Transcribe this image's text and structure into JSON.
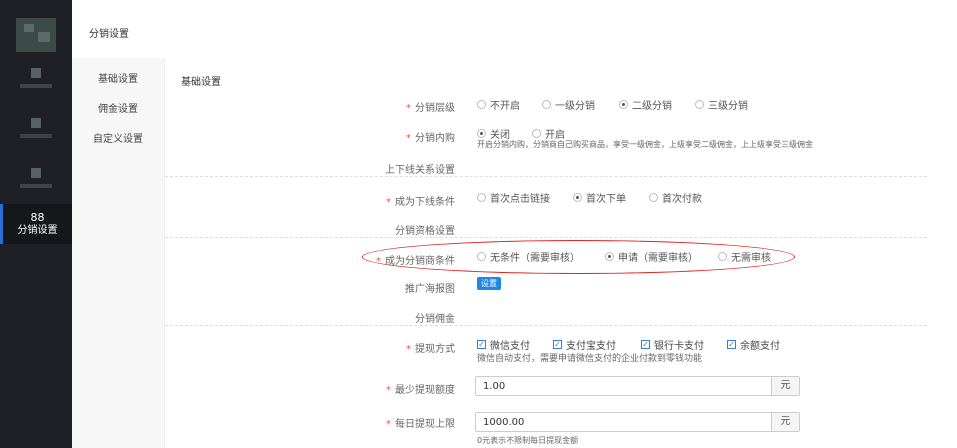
{
  "topbar": {
    "title": "分销设置"
  },
  "sidebar": {
    "active": {
      "icon": "88",
      "label": "分销设置"
    }
  },
  "subnav": {
    "items": [
      "基础设置",
      "佣金设置",
      "自定义设置"
    ]
  },
  "main": {
    "section_title": "基础设置",
    "level": {
      "label": "分销层级",
      "options": [
        "不开启",
        "一级分销",
        "二级分销",
        "三级分销"
      ],
      "selected": "二级分销"
    },
    "inner": {
      "label": "分销内购",
      "options": [
        "关闭",
        "开启"
      ],
      "selected": "关闭",
      "hint": "开启分销内购，分销商自己购买商品，享受一级佣金，上级享受二级佣金，上上级享受三级佣金"
    },
    "relation_heading": "上下线关系设置",
    "downline": {
      "label": "成为下线条件",
      "options": [
        "首次点击链接",
        "首次下单",
        "首次付款"
      ],
      "selected": "首次下单"
    },
    "qualification_heading": "分销资格设置",
    "distributor": {
      "label": "成为分销商条件",
      "options": [
        "无条件（需要审核）",
        "申请（需要审核）",
        "无需审核"
      ],
      "selected": "申请（需要审核）"
    },
    "poster": {
      "label": "推广海报图",
      "button": "设置"
    },
    "commission_heading": "分销佣金",
    "withdraw": {
      "label": "提现方式",
      "options": [
        "微信支付",
        "支付宝支付",
        "银行卡支付",
        "余额支付"
      ],
      "hint": "微信自动支付，需要申请微信支付的企业付款到零钱功能"
    },
    "min_withdraw": {
      "label": "最少提现额度",
      "value": "1.00",
      "unit": "元"
    },
    "daily_limit": {
      "label": "每日提现上限",
      "value": "1000.00",
      "unit": "元",
      "hint": "0元表示不限制每日提现金额"
    }
  }
}
